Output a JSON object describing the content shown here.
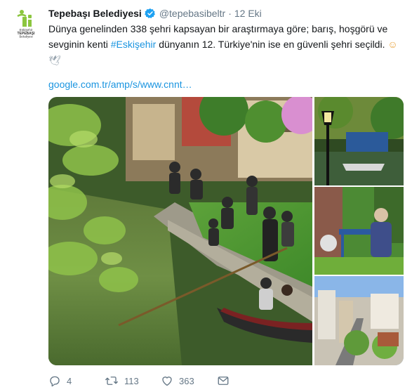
{
  "tweet": {
    "display_name": "Tepebaşı Belediyesi",
    "handle": "@tepebasibeltr",
    "separator": "·",
    "time": "12 Eki",
    "text_part1": "Dünya genelinden 338 şehri kapsayan bir araştırmaya göre; barış, hoşgörü ve sevginin kenti ",
    "hashtag": "#Eskişehir",
    "text_part2": " dünyanın 12. Türkiye'nin ise en güvenli şehri seçildi. ",
    "emoji_smile": "☺",
    "emoji_dove": "🕊",
    "link": "google.com.tr/amp/s/www.cnnt…"
  },
  "avatar": {
    "line1": "Eskişehir",
    "line2": "TEPEBAŞI",
    "line3": "Belediyesi",
    "color": "#8cc63f"
  },
  "actions": {
    "replies": "4",
    "retweets": "113",
    "likes": "363"
  },
  "colors": {
    "link": "#1b95e0",
    "muted": "#657786",
    "verified": "#1da1f2"
  },
  "icons": [
    "verified-badge-icon",
    "reply-icon",
    "retweet-icon",
    "like-icon",
    "message-icon"
  ]
}
